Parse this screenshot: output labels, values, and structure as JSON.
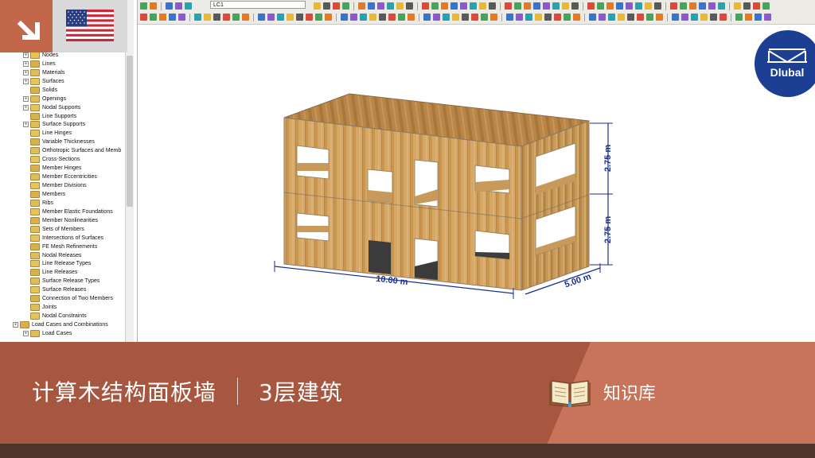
{
  "toolbar": {
    "load_case_value": "LC1"
  },
  "navigator": {
    "items": [
      {
        "label": "Nodes",
        "expandable": true,
        "level": 1
      },
      {
        "label": "Lines",
        "expandable": true,
        "level": 1
      },
      {
        "label": "Materials",
        "expandable": true,
        "level": 1
      },
      {
        "label": "Surfaces",
        "expandable": true,
        "level": 1
      },
      {
        "label": "Solids",
        "expandable": false,
        "level": 1
      },
      {
        "label": "Openings",
        "expandable": true,
        "level": 1
      },
      {
        "label": "Nodal Supports",
        "expandable": true,
        "level": 1
      },
      {
        "label": "Line Supports",
        "expandable": false,
        "level": 1
      },
      {
        "label": "Surface Supports",
        "expandable": true,
        "level": 1
      },
      {
        "label": "Line Hinges",
        "expandable": false,
        "level": 1
      },
      {
        "label": "Variable Thicknesses",
        "expandable": false,
        "level": 1
      },
      {
        "label": "Orthotropic Surfaces and Memb",
        "expandable": false,
        "level": 1
      },
      {
        "label": "Cross-Sections",
        "expandable": false,
        "level": 1
      },
      {
        "label": "Member Hinges",
        "expandable": false,
        "level": 1
      },
      {
        "label": "Member Eccentricities",
        "expandable": false,
        "level": 1
      },
      {
        "label": "Member Divisions",
        "expandable": false,
        "level": 1
      },
      {
        "label": "Members",
        "expandable": false,
        "level": 1
      },
      {
        "label": "Ribs",
        "expandable": false,
        "level": 1
      },
      {
        "label": "Member Elastic Foundations",
        "expandable": false,
        "level": 1
      },
      {
        "label": "Member Nonlinearities",
        "expandable": false,
        "level": 1
      },
      {
        "label": "Sets of Members",
        "expandable": false,
        "level": 1
      },
      {
        "label": "Intersections of Surfaces",
        "expandable": false,
        "level": 1
      },
      {
        "label": "FE Mesh Refinements",
        "expandable": false,
        "level": 1
      },
      {
        "label": "Nodal Releases",
        "expandable": false,
        "level": 1
      },
      {
        "label": "Line Release Types",
        "expandable": false,
        "level": 1
      },
      {
        "label": "Line Releases",
        "expandable": false,
        "level": 1
      },
      {
        "label": "Surface Release Types",
        "expandable": false,
        "level": 1
      },
      {
        "label": "Surface Releases",
        "expandable": false,
        "level": 1
      },
      {
        "label": "Connection of Two Members",
        "expandable": false,
        "level": 1
      },
      {
        "label": "Joints",
        "expandable": false,
        "level": 1
      },
      {
        "label": "Nodal Constraints",
        "expandable": false,
        "level": 1
      },
      {
        "label": "Load Cases and Combinations",
        "expandable": true,
        "level": 0
      },
      {
        "label": "Load Cases",
        "expandable": true,
        "level": 1
      }
    ]
  },
  "model": {
    "dim_length": "10.00 m",
    "dim_width": "5.00 m",
    "dim_height_upper": "2.75 m",
    "dim_height_lower": "2.75 m"
  },
  "brand": {
    "name": "Dlubal"
  },
  "banner": {
    "title": "计算木结构面板墙",
    "subtitle": "3层建筑",
    "knowledge_base": "知识库"
  },
  "colors": {
    "accent": "#c2674a",
    "banner_dark": "#a7573f",
    "banner_light": "#c8745a",
    "bottom_bar": "#4e342b",
    "dimension": "#1a2f8f",
    "dlubal_blue": "#1c3f94",
    "wood": "#d2a463"
  },
  "icons": {
    "corner": "arrow-down-right-icon",
    "flag": "us-flag-icon",
    "knowledge_base": "open-book-icon",
    "brand": "dlubal-bridge-logo"
  }
}
